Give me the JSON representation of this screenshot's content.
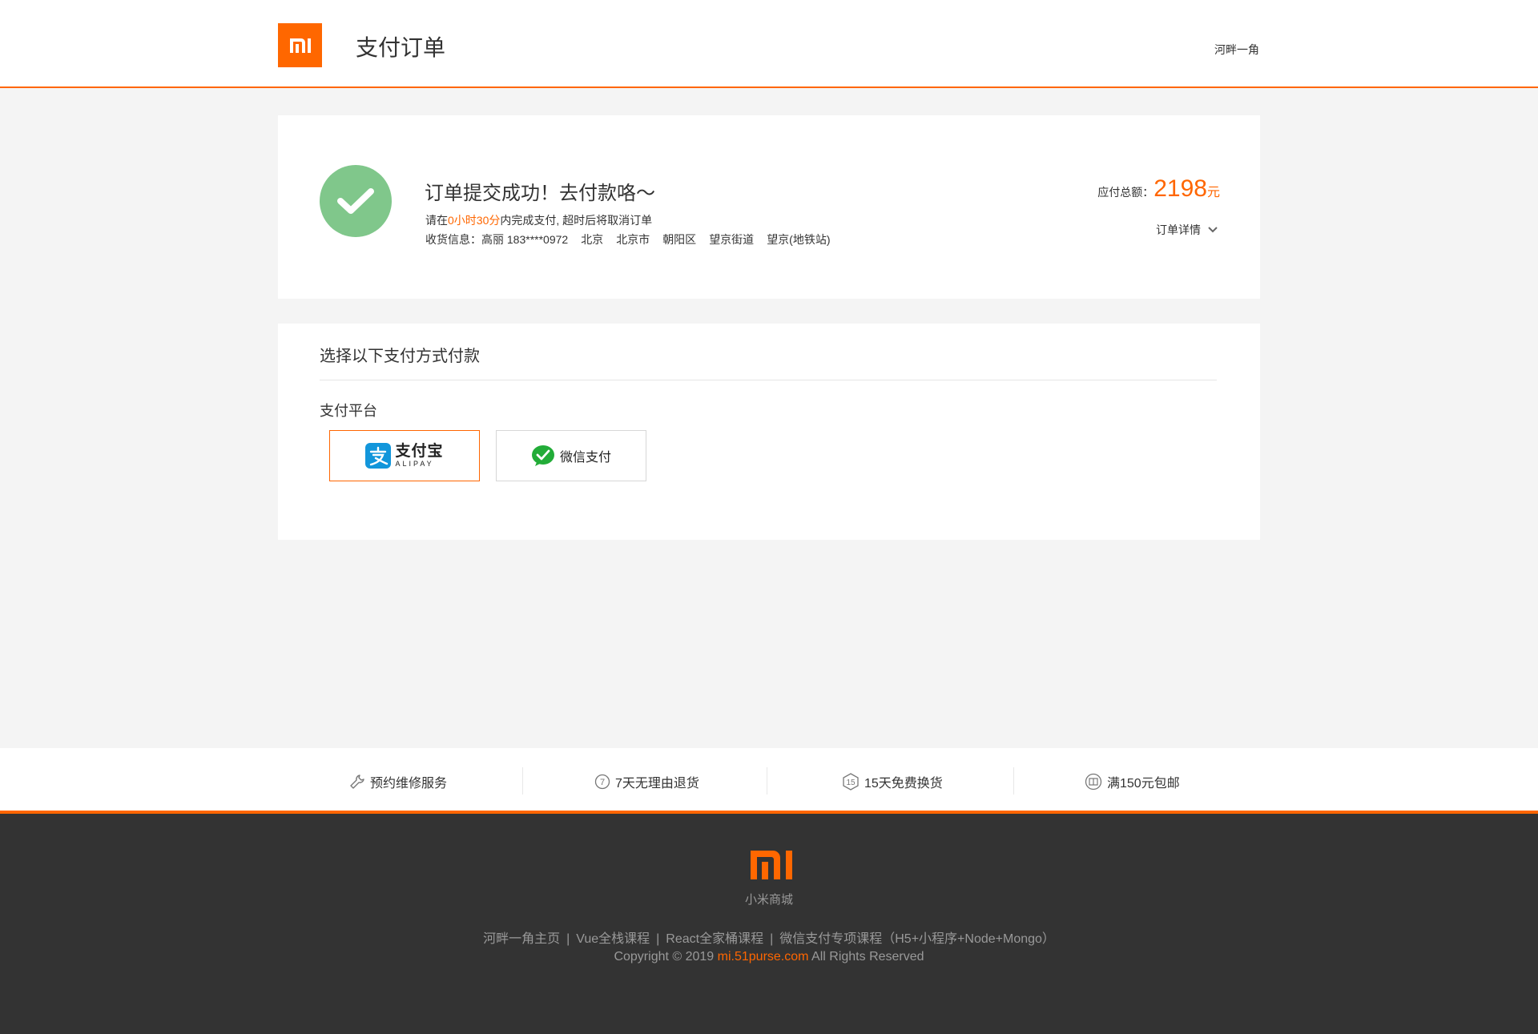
{
  "header": {
    "logo_text": "mi",
    "title": "支付订单",
    "username": "河畔一角"
  },
  "order": {
    "title": "订单提交成功！去付款咯～",
    "deadline_prefix": "请在",
    "deadline_time": "0小时30分",
    "deadline_suffix": "内完成支付, 超时后将取消订单",
    "shipping_label": "收货信息：",
    "shipping_name_phone": "高丽 183****0972",
    "address_parts": [
      "北京",
      "北京市",
      "朝阳区",
      "望京街道",
      "望京(地铁站)"
    ],
    "total_label": "应付总额：",
    "total_value": "2198",
    "total_unit": "元",
    "detail_label": "订单详情"
  },
  "payment": {
    "heading": "选择以下支付方式付款",
    "platform_label": "支付平台",
    "alipay_cn": "支付宝",
    "alipay_en": "ALIPAY",
    "wechat_label": "微信支付",
    "selected": "alipay"
  },
  "services": [
    {
      "label": "预约维修服务",
      "icon": "wrench-icon"
    },
    {
      "label": "7天无理由退货",
      "icon": "seven-day-icon"
    },
    {
      "label": "15天免费换货",
      "icon": "fifteen-day-icon"
    },
    {
      "label": "满150元包邮",
      "icon": "free-shipping-icon"
    }
  ],
  "footer": {
    "brand": "小米商城",
    "links": [
      "河畔一角主页",
      "Vue全栈课程",
      "React全家桶课程",
      "微信支付专项课程（H5+小程序+Node+Mongo）"
    ],
    "link_separator": "|",
    "copyright_prefix": "Copyright © 2019",
    "copyright_site": "mi.51purse.com",
    "copyright_suffix": "All Rights Reserved"
  },
  "colors": {
    "accent": "#ff6600",
    "success": "#80c78b",
    "footer_bg": "#333333"
  }
}
